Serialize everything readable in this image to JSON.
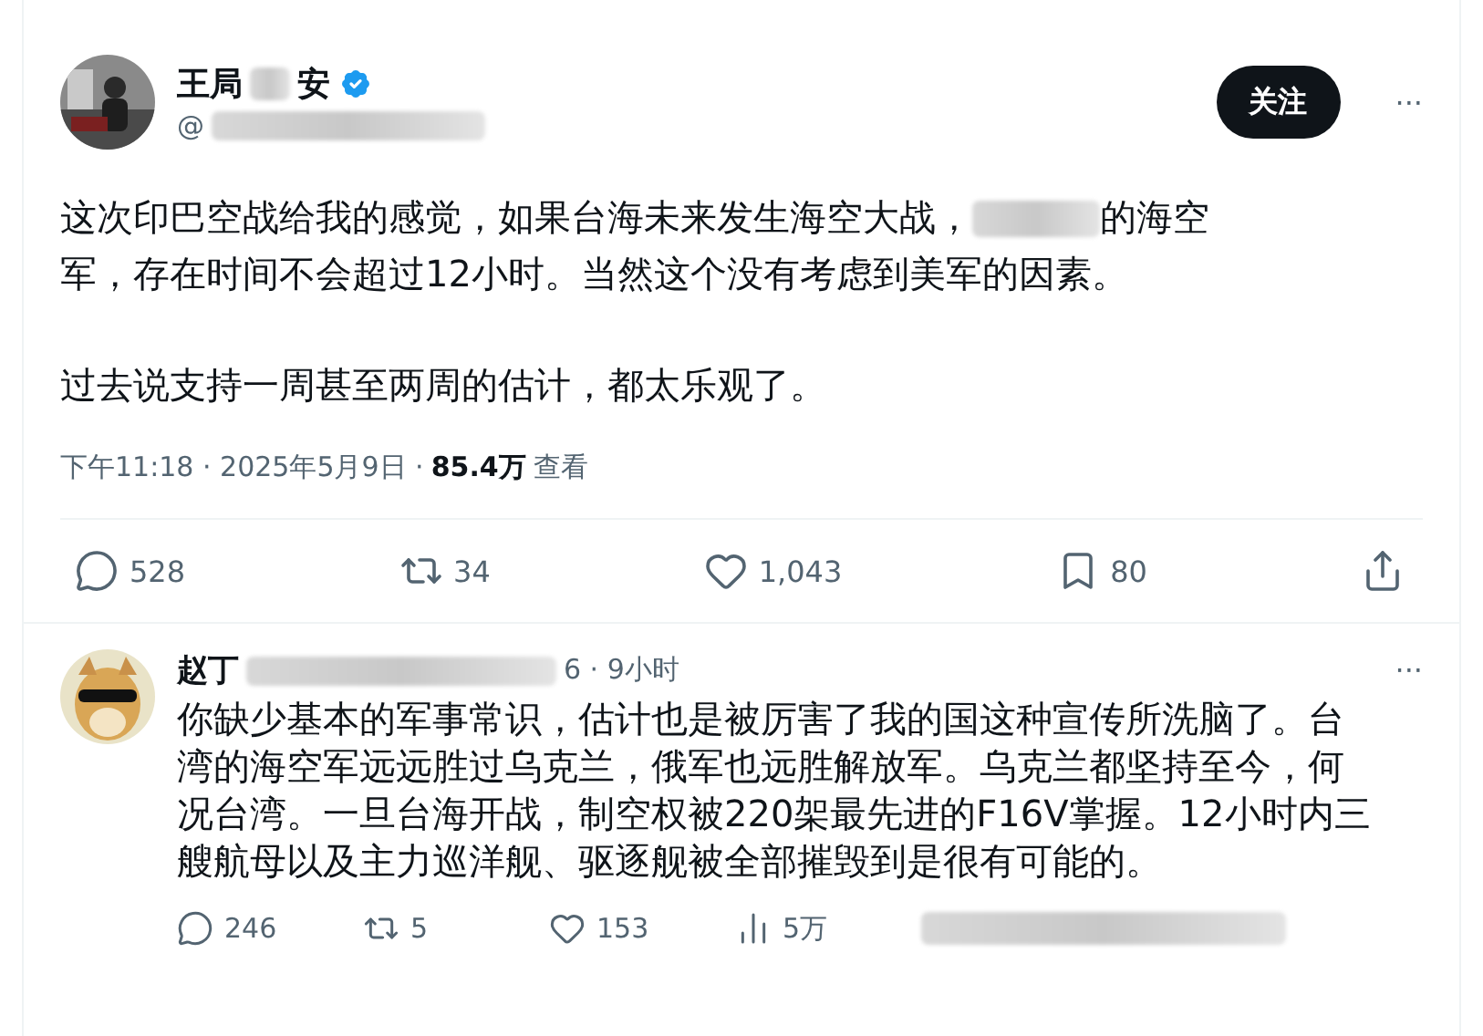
{
  "post": {
    "name": "王局",
    "name_tail": "安",
    "verified": true,
    "handle_prefix": "@",
    "follow_label": "关注",
    "more": "···",
    "body_start": "这次印巴空战给我的感觉，如果台海未来发生海空大战，",
    "body_mid": "的海空",
    "body_end": "军，存在时间不会超过12小时。当然这个没有考虑到美军的因素。",
    "body_2": "过去说支持一周甚至两周的估计，都太乐观了。",
    "time": "下午11:18 · 2025年5月9日 · ",
    "views": "85.4万",
    "views_label": "查看",
    "actions": [
      {
        "kind": "reply",
        "count": "528"
      },
      {
        "kind": "repost",
        "count": "34"
      },
      {
        "kind": "like",
        "count": "1,043"
      },
      {
        "kind": "bookmark",
        "count": "80"
      },
      {
        "kind": "share"
      }
    ]
  },
  "reply": {
    "name": "赵丁",
    "handle_tail": "6 · 9小时",
    "more": "···",
    "body": "你缺少基本的军事常识，估计也是被厉害了我的国这种宣传所洗脑了。台湾的海空军远远胜过乌克兰，俄军也远胜解放军。乌克兰都坚持至今，何况台湾。一旦台海开战，制空权被220架最先进的F16V掌握。12小时内三艘航母以及主力巡洋舰、驱逐舰被全部摧毁到是很有可能的。",
    "actions": [
      {
        "kind": "reply",
        "count": "246"
      },
      {
        "kind": "repost",
        "count": "5"
      },
      {
        "kind": "like",
        "count": "153"
      },
      {
        "kind": "views",
        "count": "5万"
      }
    ]
  }
}
